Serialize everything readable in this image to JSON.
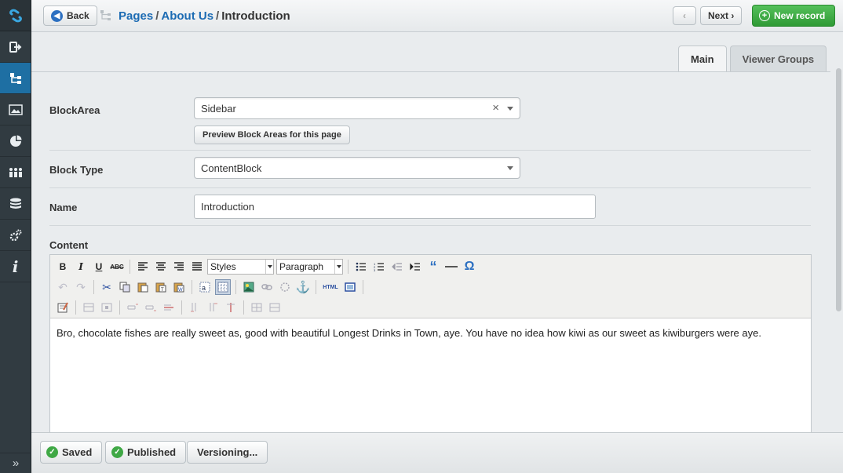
{
  "header": {
    "back_label": "Back",
    "breadcrumb": {
      "crumb1": "Pages",
      "crumb2": "About Us",
      "current": "Introduction",
      "separator": "/"
    },
    "prev_label": "‹",
    "next_label": "Next ›",
    "new_record_label": "New record"
  },
  "tabs": [
    {
      "label": "Main"
    },
    {
      "label": "Viewer Groups"
    }
  ],
  "form": {
    "block_area": {
      "label": "BlockArea",
      "value": "Sidebar",
      "preview_button": "Preview Block Areas for this page"
    },
    "block_type": {
      "label": "Block Type",
      "value": "ContentBlock"
    },
    "name": {
      "label": "Name",
      "value": "Introduction"
    },
    "content": {
      "label": "Content",
      "styles_select": "Styles",
      "format_select": "Paragraph",
      "html_button": "HTML",
      "body_text": "Bro, chocolate fishes are really sweet as, good with beautiful Longest Drinks in Town, aye. You have no idea how kiwi as our sweet as kiwiburgers were aye."
    }
  },
  "footer": {
    "saved_label": "Saved",
    "published_label": "Published",
    "versioning_label": "Versioning..."
  },
  "colors": {
    "accent": "#1e6fa3",
    "link": "#1c6bb3",
    "success": "#3fa845",
    "rail": "#313b41"
  },
  "rail_items": [
    "logo-icon",
    "logout-icon",
    "site-tree-icon",
    "image-icon",
    "pie-chart-icon",
    "users-icon",
    "database-icon",
    "gears-icon",
    "info-icon"
  ]
}
